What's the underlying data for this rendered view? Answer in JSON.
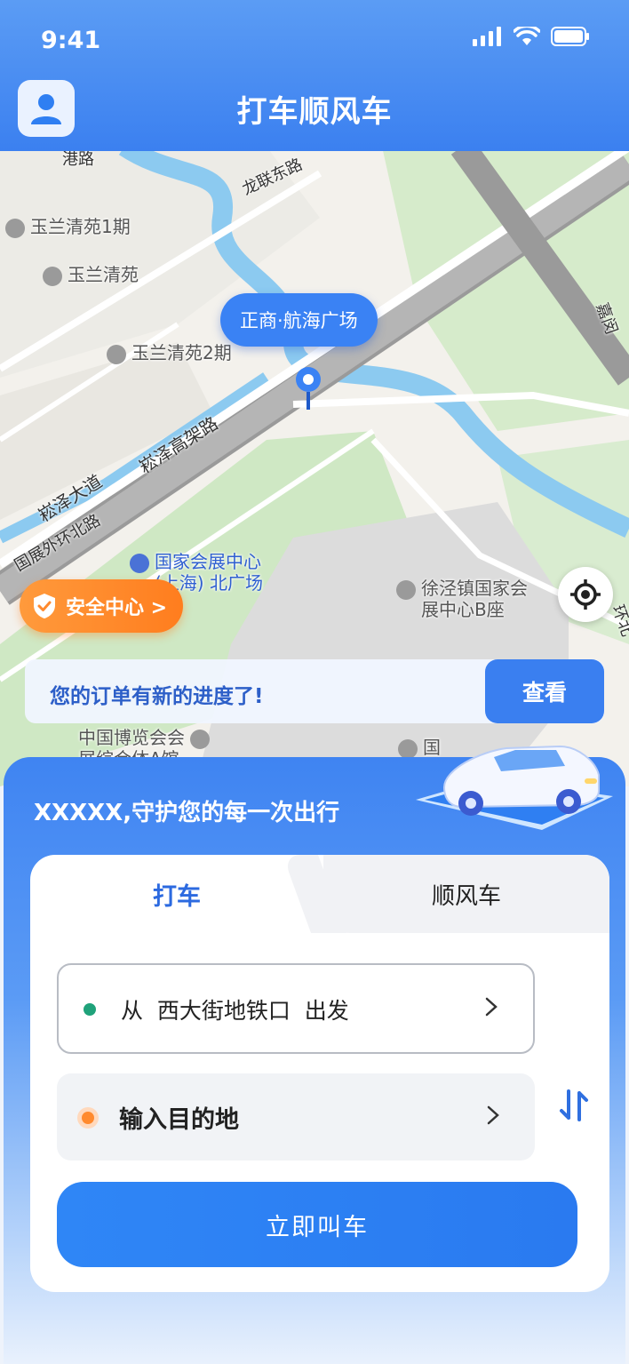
{
  "status": {
    "time": "9:41"
  },
  "header": {
    "title": "打车顺风车"
  },
  "map": {
    "pin_label": "正商·航海广场",
    "labels": {
      "poi1": "玉兰清苑1期",
      "poi2": "玉兰清苑",
      "poi3": "玉兰清苑2期",
      "road_longlian": "龙联东路",
      "road_songze_highway": "崧泽高架路",
      "road_songze_avenue": "崧泽大道",
      "road_guozhan": "国展外环北路",
      "expo_line1": "国家会展中心",
      "expo_line2": "(上海) 北广场",
      "xujing_line1": "徐泾镇国家会",
      "xujing_line2": "展中心B座",
      "museum_line1": "中国博览会会",
      "museum_line2": "展综合体A馆",
      "top_road": "港路",
      "right_road": "嘉闵",
      "right_road2": "环北",
      "bottom_right": "国"
    },
    "safety_button": "安全中心 >",
    "notice": {
      "text": "您的订单有新的进度了!",
      "button": "查看"
    }
  },
  "panel": {
    "slogan": "XXXXX,守护您的每一次出行",
    "tabs": {
      "active": "打车",
      "inactive": "顺风车"
    },
    "from": "从  西大街地铁口  出发",
    "to": "输入目的地",
    "call_button": "立即叫车"
  }
}
